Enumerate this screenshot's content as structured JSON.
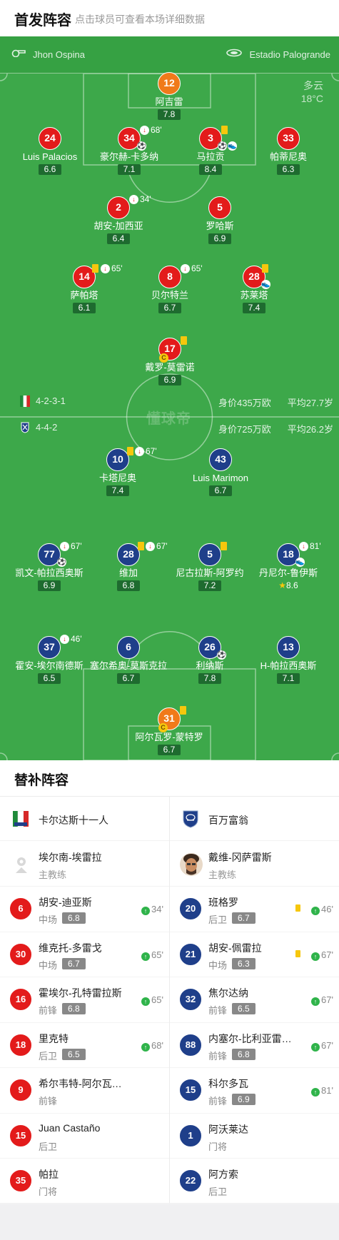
{
  "header": {
    "title": "首发阵容",
    "hint": "点击球员可查看本场详细数据"
  },
  "match_info": {
    "referee": "Jhon Ospina",
    "stadium": "Estadio Palogrande",
    "weather": "多云",
    "temperature": "18°C"
  },
  "home": {
    "formation": "4-2-3-1",
    "value": "身价435万欧",
    "avg_age": "平均27.7岁",
    "players": [
      {
        "num": "12",
        "name": "阿吉雷",
        "rating": "7.8"
      },
      {
        "num": "24",
        "name": "Luis Palacios",
        "rating": "6.6"
      },
      {
        "num": "34",
        "name": "豪尔赫-卡多纳",
        "rating": "7.1",
        "sub": "68'"
      },
      {
        "num": "3",
        "name": "马拉贡",
        "rating": "8.4"
      },
      {
        "num": "33",
        "name": "帕蒂尼奥",
        "rating": "6.3"
      },
      {
        "num": "2",
        "name": "胡安-加西亚",
        "rating": "6.4",
        "sub": "34'"
      },
      {
        "num": "5",
        "name": "罗哈斯",
        "rating": "6.9"
      },
      {
        "num": "14",
        "name": "萨帕塔",
        "rating": "6.1",
        "sub": "65'"
      },
      {
        "num": "8",
        "name": "贝尔特兰",
        "rating": "6.7",
        "sub": "65'"
      },
      {
        "num": "28",
        "name": "苏莱塔",
        "rating": "7.4"
      },
      {
        "num": "17",
        "name": "戴罗-莫雷诺",
        "rating": "6.9"
      }
    ]
  },
  "away": {
    "formation": "4-4-2",
    "value": "身价725万欧",
    "avg_age": "平均26.2岁",
    "players": [
      {
        "num": "10",
        "name": "卡塔尼奥",
        "rating": "7.4",
        "sub": "67'"
      },
      {
        "num": "43",
        "name": "Luis Marimon",
        "rating": "6.7"
      },
      {
        "num": "77",
        "name": "凯文-帕拉西奥斯",
        "rating": "6.9",
        "sub": "67'"
      },
      {
        "num": "28",
        "name": "维加",
        "rating": "6.8",
        "sub": "67'"
      },
      {
        "num": "5",
        "name": "尼古拉斯-阿罗约",
        "rating": "7.2"
      },
      {
        "num": "18",
        "name": "丹尼尔-鲁伊斯",
        "rating": "8.6",
        "sub": "81'"
      },
      {
        "num": "37",
        "name": "霍安-埃尔南德斯",
        "rating": "6.5",
        "sub": "46'"
      },
      {
        "num": "6",
        "name": "塞尔希奥-莫斯克拉",
        "rating": "6.7"
      },
      {
        "num": "26",
        "name": "利纳斯",
        "rating": "7.8"
      },
      {
        "num": "13",
        "name": "H-帕拉西奥斯",
        "rating": "7.1"
      },
      {
        "num": "31",
        "name": "阿尔瓦罗-蒙特罗",
        "rating": "6.7"
      }
    ]
  },
  "watermark": "懂球帝",
  "subs": {
    "title": "替补阵容",
    "home": {
      "team": "卡尔达斯十一人",
      "coach": {
        "name": "埃尔南-埃雷拉",
        "role": "主教练"
      },
      "list": [
        {
          "num": "6",
          "name": "胡安-迪亚斯",
          "pos": "中场",
          "rating": "6.8",
          "time": "34'"
        },
        {
          "num": "30",
          "name": "维克托-多雷戈",
          "pos": "中场",
          "rating": "6.7",
          "time": "65'"
        },
        {
          "num": "16",
          "name": "霍埃尔-孔特雷拉斯",
          "pos": "前锋",
          "rating": "6.8",
          "time": "65'"
        },
        {
          "num": "18",
          "name": "里克特",
          "pos": "后卫",
          "rating": "6.5",
          "time": "68'"
        },
        {
          "num": "9",
          "name": "希尔韦特-阿尔瓦雷斯",
          "pos": "前锋"
        },
        {
          "num": "15",
          "name": "Juan Castaño",
          "pos": "后卫"
        },
        {
          "num": "35",
          "name": "帕拉",
          "pos": "门将"
        }
      ]
    },
    "away": {
      "team": "百万富翁",
      "coach": {
        "name": "戴维-冈萨雷斯",
        "role": "主教练"
      },
      "list": [
        {
          "num": "20",
          "name": "班格罗",
          "pos": "后卫",
          "rating": "6.7",
          "time": "46'",
          "yc": true
        },
        {
          "num": "21",
          "name": "胡安-佩雷拉",
          "pos": "中场",
          "rating": "6.3",
          "time": "67'",
          "yc": true
        },
        {
          "num": "32",
          "name": "焦尔达纳",
          "pos": "前锋",
          "rating": "6.5",
          "time": "67'"
        },
        {
          "num": "88",
          "name": "内塞尔-比利亚雷亚尔",
          "pos": "前锋",
          "rating": "6.8",
          "time": "67'"
        },
        {
          "num": "15",
          "name": "科尔多瓦",
          "pos": "前锋",
          "rating": "6.9",
          "time": "81'"
        },
        {
          "num": "1",
          "name": "阿沃莱达",
          "pos": "门将"
        },
        {
          "num": "22",
          "name": "阿方索",
          "pos": "后卫"
        }
      ]
    }
  }
}
